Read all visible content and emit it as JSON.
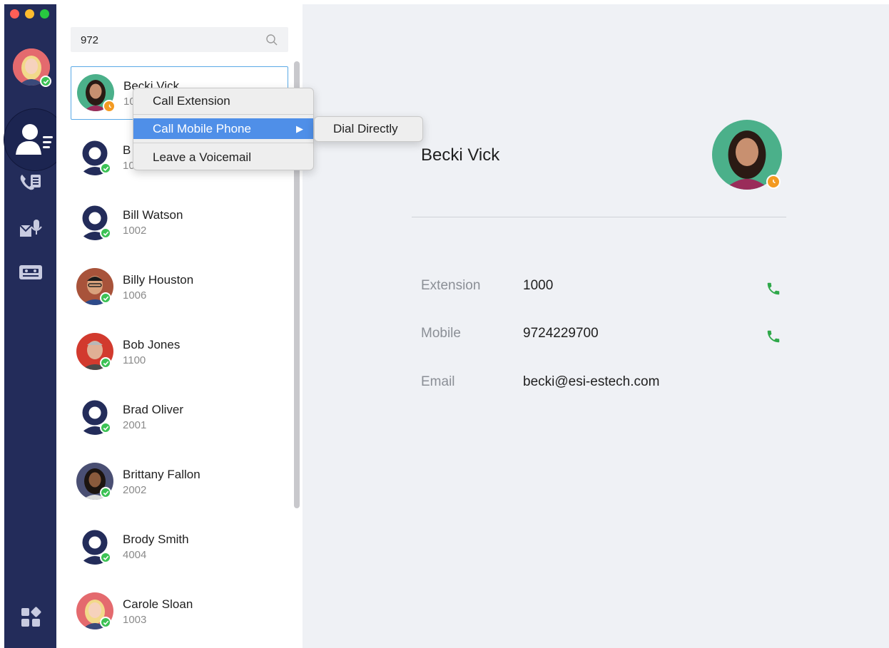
{
  "window": {
    "traffic_lights": {
      "close": "#ff5f57",
      "minimize": "#febc2e",
      "zoom": "#28c840"
    }
  },
  "rail": {
    "background": "#232c5a",
    "items": [
      {
        "icon": "contacts-icon",
        "active": true
      },
      {
        "icon": "call-history-icon",
        "active": false
      },
      {
        "icon": "voicemail-icon",
        "active": false
      },
      {
        "icon": "fax-icon",
        "active": false
      },
      {
        "icon": "apps-grid-icon",
        "active": false
      }
    ]
  },
  "search": {
    "value": "972"
  },
  "contacts": [
    {
      "name": "Becki Vick",
      "ext": "1000",
      "status": "away",
      "avatar": "photo-woman-dark",
      "selected": true
    },
    {
      "name": "B",
      "ext": "10",
      "status": "available",
      "avatar": "placeholder",
      "selected": false
    },
    {
      "name": "Bill Watson",
      "ext": "1002",
      "status": "available",
      "avatar": "placeholder",
      "selected": false
    },
    {
      "name": "Billy Houston",
      "ext": "1006",
      "status": "available",
      "avatar": "photo-man-glasses",
      "selected": false
    },
    {
      "name": "Bob Jones",
      "ext": "1100",
      "status": "available",
      "avatar": "photo-man-grey",
      "selected": false
    },
    {
      "name": "Brad Oliver",
      "ext": "2001",
      "status": "available",
      "avatar": "placeholder",
      "selected": false
    },
    {
      "name": "Brittany Fallon",
      "ext": "2002",
      "status": "available",
      "avatar": "photo-woman-curly",
      "selected": false
    },
    {
      "name": "Brody Smith",
      "ext": "4004",
      "status": "available",
      "avatar": "placeholder",
      "selected": false
    },
    {
      "name": "Carole Sloan",
      "ext": "1003",
      "status": "available",
      "avatar": "photo-woman-blonde",
      "selected": false
    }
  ],
  "context_menu": {
    "items": [
      "Call Extension",
      "Call Mobile Phone",
      "Leave a Voicemail"
    ],
    "active_index": 1,
    "submenu": [
      "Dial Directly"
    ]
  },
  "detail": {
    "name": "Becki Vick",
    "rows": [
      {
        "label": "Extension",
        "value": "1000",
        "callable": true
      },
      {
        "label": "Mobile",
        "value": "9724229700",
        "callable": true
      },
      {
        "label": "Email",
        "value": "becki@esi-estech.com",
        "callable": false
      }
    ]
  },
  "colors": {
    "available": "#3cc255",
    "away": "#f39a21",
    "selection_border": "#5aa9e6",
    "menu_highlight": "#4f8fe8",
    "call_green": "#2fa84a"
  }
}
